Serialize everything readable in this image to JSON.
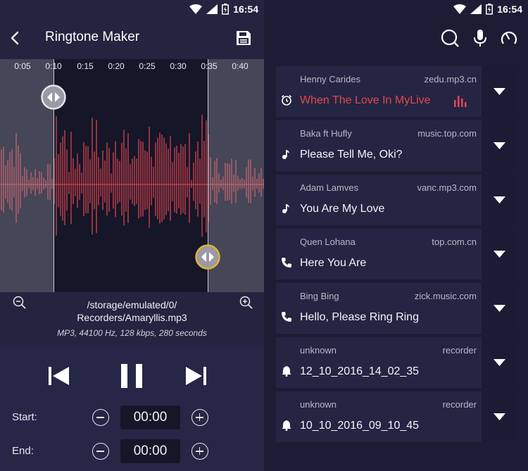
{
  "status": {
    "time": "16:54"
  },
  "editor": {
    "title": "Ringtone Maker",
    "timeline": [
      "0:05",
      "0:10",
      "0:15",
      "0:20",
      "0:25",
      "0:30",
      "0:35",
      "0:40"
    ],
    "file_path": "/storage/emulated/0/\nRecorders/Amaryllis.mp3",
    "file_info": "MP3, 44100 Hz, 128 kbps, 280 seconds",
    "start_label": "Start:",
    "end_label": "End:",
    "start_value": "00:00",
    "end_value": "00:00",
    "colors": {
      "wave": "#e5474f",
      "accent_handle": "#e6b52a"
    }
  },
  "library": {
    "items": [
      {
        "artist": "Henny Carides",
        "source": "zedu.mp3.cn",
        "song": "When The Love In MyLive",
        "type_icon": "alarm-icon",
        "active": true
      },
      {
        "artist": "Baka ft Hufly",
        "source": "music.top.com",
        "song": "Please Tell Me, Oki?",
        "type_icon": "music-note-icon",
        "active": false
      },
      {
        "artist": "Adam Lamves",
        "source": "vanc.mp3.com",
        "song": "You Are My Love",
        "type_icon": "music-note-icon",
        "active": false
      },
      {
        "artist": "Quen Lohana",
        "source": "top.com.cn",
        "song": "Here You Are",
        "type_icon": "phone-icon",
        "active": false
      },
      {
        "artist": "Bing Bing",
        "source": "zick.music.com",
        "song": "Hello, Please Ring Ring",
        "type_icon": "phone-icon",
        "active": false
      },
      {
        "artist": "unknown",
        "source": "recorder",
        "song": "12_10_2016_14_02_35",
        "type_icon": "bell-icon",
        "active": false
      },
      {
        "artist": "unknown",
        "source": "recorder",
        "song": "10_10_2016_09_10_45",
        "type_icon": "bell-icon",
        "active": false
      }
    ],
    "colors": {
      "active": "#e8454e"
    }
  }
}
